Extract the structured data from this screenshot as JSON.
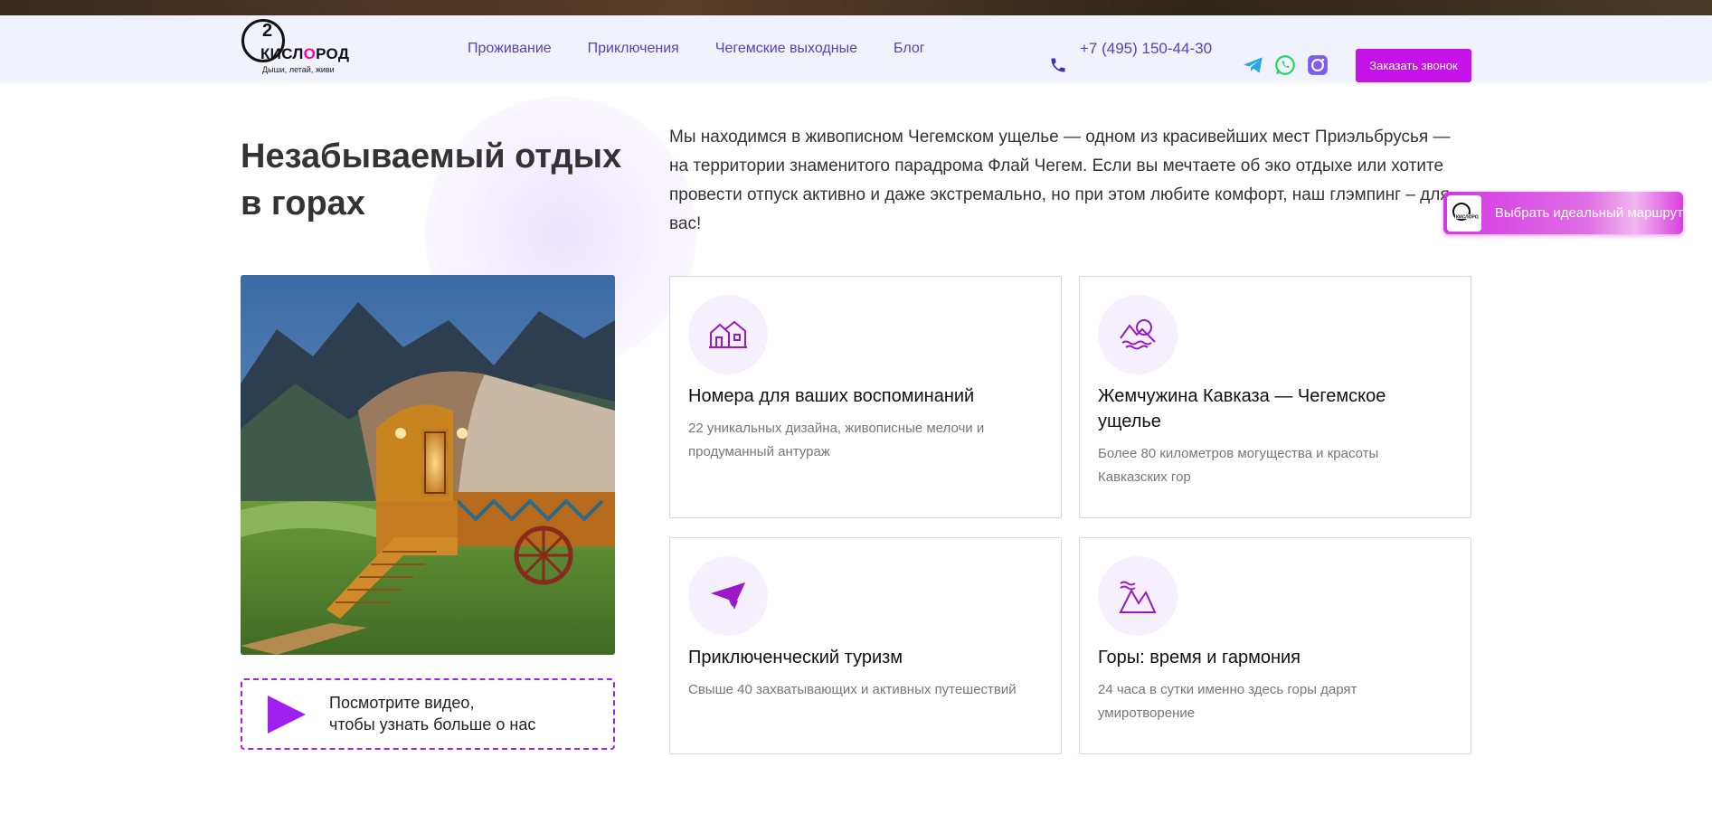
{
  "header": {
    "logo": {
      "mark": "2",
      "word_pre": "КИСЛ",
      "word_o": "О",
      "word_post": "РОД",
      "tagline": "Дыши, летай, живи"
    },
    "nav": [
      "Проживание",
      "Приключения",
      "Чегемские выходные",
      "Блог"
    ],
    "phone": "+7 (495) 150-44-30",
    "call_button": "Заказать звонок"
  },
  "hero": {
    "headline": "Незабываемый отдых в горах",
    "intro": "Мы находимся в живописном Чегемском ущелье — одном из красивейших мест Приэльбрусья — на территории знаменитого парадрома Флай Чегем. Если вы мечтаете об эко отдыхе или хотите провести отпуск активно и даже экстремально, но при этом любите комфорт, наш глэмпинг – для вас!"
  },
  "route_button": "Выбрать идеальный маршрут",
  "video": {
    "line1": "Посмотрите видео,",
    "line2": "чтобы узнать больше о нас"
  },
  "features": [
    {
      "icon": "houses-icon",
      "title": "Номера для ваших воспоминаний",
      "desc": "22 уникальных дизайна, живописные мелочи и продуманный антураж"
    },
    {
      "icon": "mountain-pearl-icon",
      "title": "Жемчужина Кавказа — Чегемское ущелье",
      "desc": "Более 80 километров могущества и красоты Кавказских гор"
    },
    {
      "icon": "hang-glider-icon",
      "title": "Приключенческий туризм",
      "desc": "Свыше 40 захватывающих и активных путешествий"
    },
    {
      "icon": "mountains-icon",
      "title": "Горы: время и гармония",
      "desc": "24 часа в сутки именно здесь горы дарят умиротворение"
    }
  ],
  "colors": {
    "accent": "#c412e8",
    "nav_text": "#5a3fc0",
    "icon_purple": "#9b17c8",
    "header_bg": "#f0f3fb"
  }
}
